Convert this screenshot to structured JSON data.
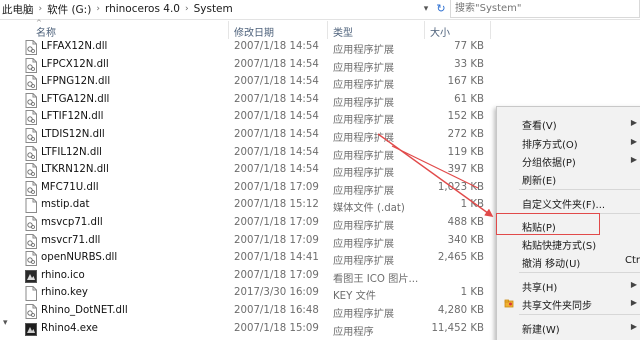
{
  "address_bar": {
    "crumbs": [
      "此电脑",
      "软件 (G:)",
      "rhinoceros 4.0",
      "System"
    ],
    "separator": "›",
    "search_placeholder": "搜索\"System\""
  },
  "columns": {
    "name": "名称",
    "date": "修改日期",
    "type": "类型",
    "size": "大小"
  },
  "files": [
    {
      "name": "LFFAX12N.dll",
      "date": "2007/1/18 14:54",
      "type": "应用程序扩展",
      "size": "77 KB",
      "icon": "dll-file-icon"
    },
    {
      "name": "LFPCX12N.dll",
      "date": "2007/1/18 14:54",
      "type": "应用程序扩展",
      "size": "33 KB",
      "icon": "dll-file-icon"
    },
    {
      "name": "LFPNG12N.dll",
      "date": "2007/1/18 14:54",
      "type": "应用程序扩展",
      "size": "167 KB",
      "icon": "dll-file-icon"
    },
    {
      "name": "LFTGA12N.dll",
      "date": "2007/1/18 14:54",
      "type": "应用程序扩展",
      "size": "61 KB",
      "icon": "dll-file-icon"
    },
    {
      "name": "LFTIF12N.dll",
      "date": "2007/1/18 14:54",
      "type": "应用程序扩展",
      "size": "152 KB",
      "icon": "dll-file-icon"
    },
    {
      "name": "LTDIS12N.dll",
      "date": "2007/1/18 14:54",
      "type": "应用程序扩展",
      "size": "272 KB",
      "icon": "dll-file-icon"
    },
    {
      "name": "LTFIL12N.dll",
      "date": "2007/1/18 14:54",
      "type": "应用程序扩展",
      "size": "119 KB",
      "icon": "dll-file-icon"
    },
    {
      "name": "LTKRN12N.dll",
      "date": "2007/1/18 14:54",
      "type": "应用程序扩展",
      "size": "397 KB",
      "icon": "dll-file-icon"
    },
    {
      "name": "MFC71U.dll",
      "date": "2007/1/18 17:09",
      "type": "应用程序扩展",
      "size": "1,023 KB",
      "icon": "dll-file-icon"
    },
    {
      "name": "mstip.dat",
      "date": "2007/1/18 15:12",
      "type": "媒体文件 (.dat)",
      "size": "1 KB",
      "icon": "dat-file-icon"
    },
    {
      "name": "msvcp71.dll",
      "date": "2007/1/18 17:09",
      "type": "应用程序扩展",
      "size": "488 KB",
      "icon": "dll-file-icon"
    },
    {
      "name": "msvcr71.dll",
      "date": "2007/1/18 17:09",
      "type": "应用程序扩展",
      "size": "340 KB",
      "icon": "dll-file-icon"
    },
    {
      "name": "openNURBS.dll",
      "date": "2007/1/18 14:41",
      "type": "应用程序扩展",
      "size": "2,465 KB",
      "icon": "dll-file-icon"
    },
    {
      "name": "rhino.ico",
      "date": "2007/1/18 17:09",
      "type": "看图王 ICO 图片...",
      "size": "",
      "icon": "ico-file-icon"
    },
    {
      "name": "rhino.key",
      "date": "2017/3/30 16:09",
      "type": "KEY 文件",
      "size": "1 KB",
      "icon": "blank-file-icon"
    },
    {
      "name": "Rhino_DotNET.dll",
      "date": "2007/1/18 16:48",
      "type": "应用程序扩展",
      "size": "4,280 KB",
      "icon": "dll-file-icon"
    },
    {
      "name": "Rhino4.exe",
      "date": "2007/1/18 15:09",
      "type": "应用程序",
      "size": "11,452 KB",
      "icon": "exe-file-icon"
    }
  ],
  "context_menu": {
    "items": [
      {
        "label": "查看(V)",
        "submenu": true
      },
      {
        "label": "排序方式(O)",
        "submenu": true
      },
      {
        "label": "分组依据(P)",
        "submenu": true
      },
      {
        "label": "刷新(E)",
        "submenu": false
      },
      {
        "label": "自定义文件夹(F)...",
        "submenu": false
      },
      {
        "label": "粘贴(P)",
        "submenu": false,
        "highlighted": true
      },
      {
        "label": "粘贴快捷方式(S)",
        "submenu": false
      },
      {
        "label": "撤消 移动(U)",
        "extra": "Ctrl",
        "submenu": false
      },
      {
        "label": "共享(H)",
        "submenu": true
      },
      {
        "label": "共享文件夹同步",
        "submenu": true,
        "icon": "sync-folder-icon"
      },
      {
        "label": "新建(W)",
        "submenu": true
      }
    ]
  },
  "colors": {
    "annotation": "#e14a4a",
    "header_text": "#4c607a",
    "menu_bg": "#f2f2f2"
  }
}
